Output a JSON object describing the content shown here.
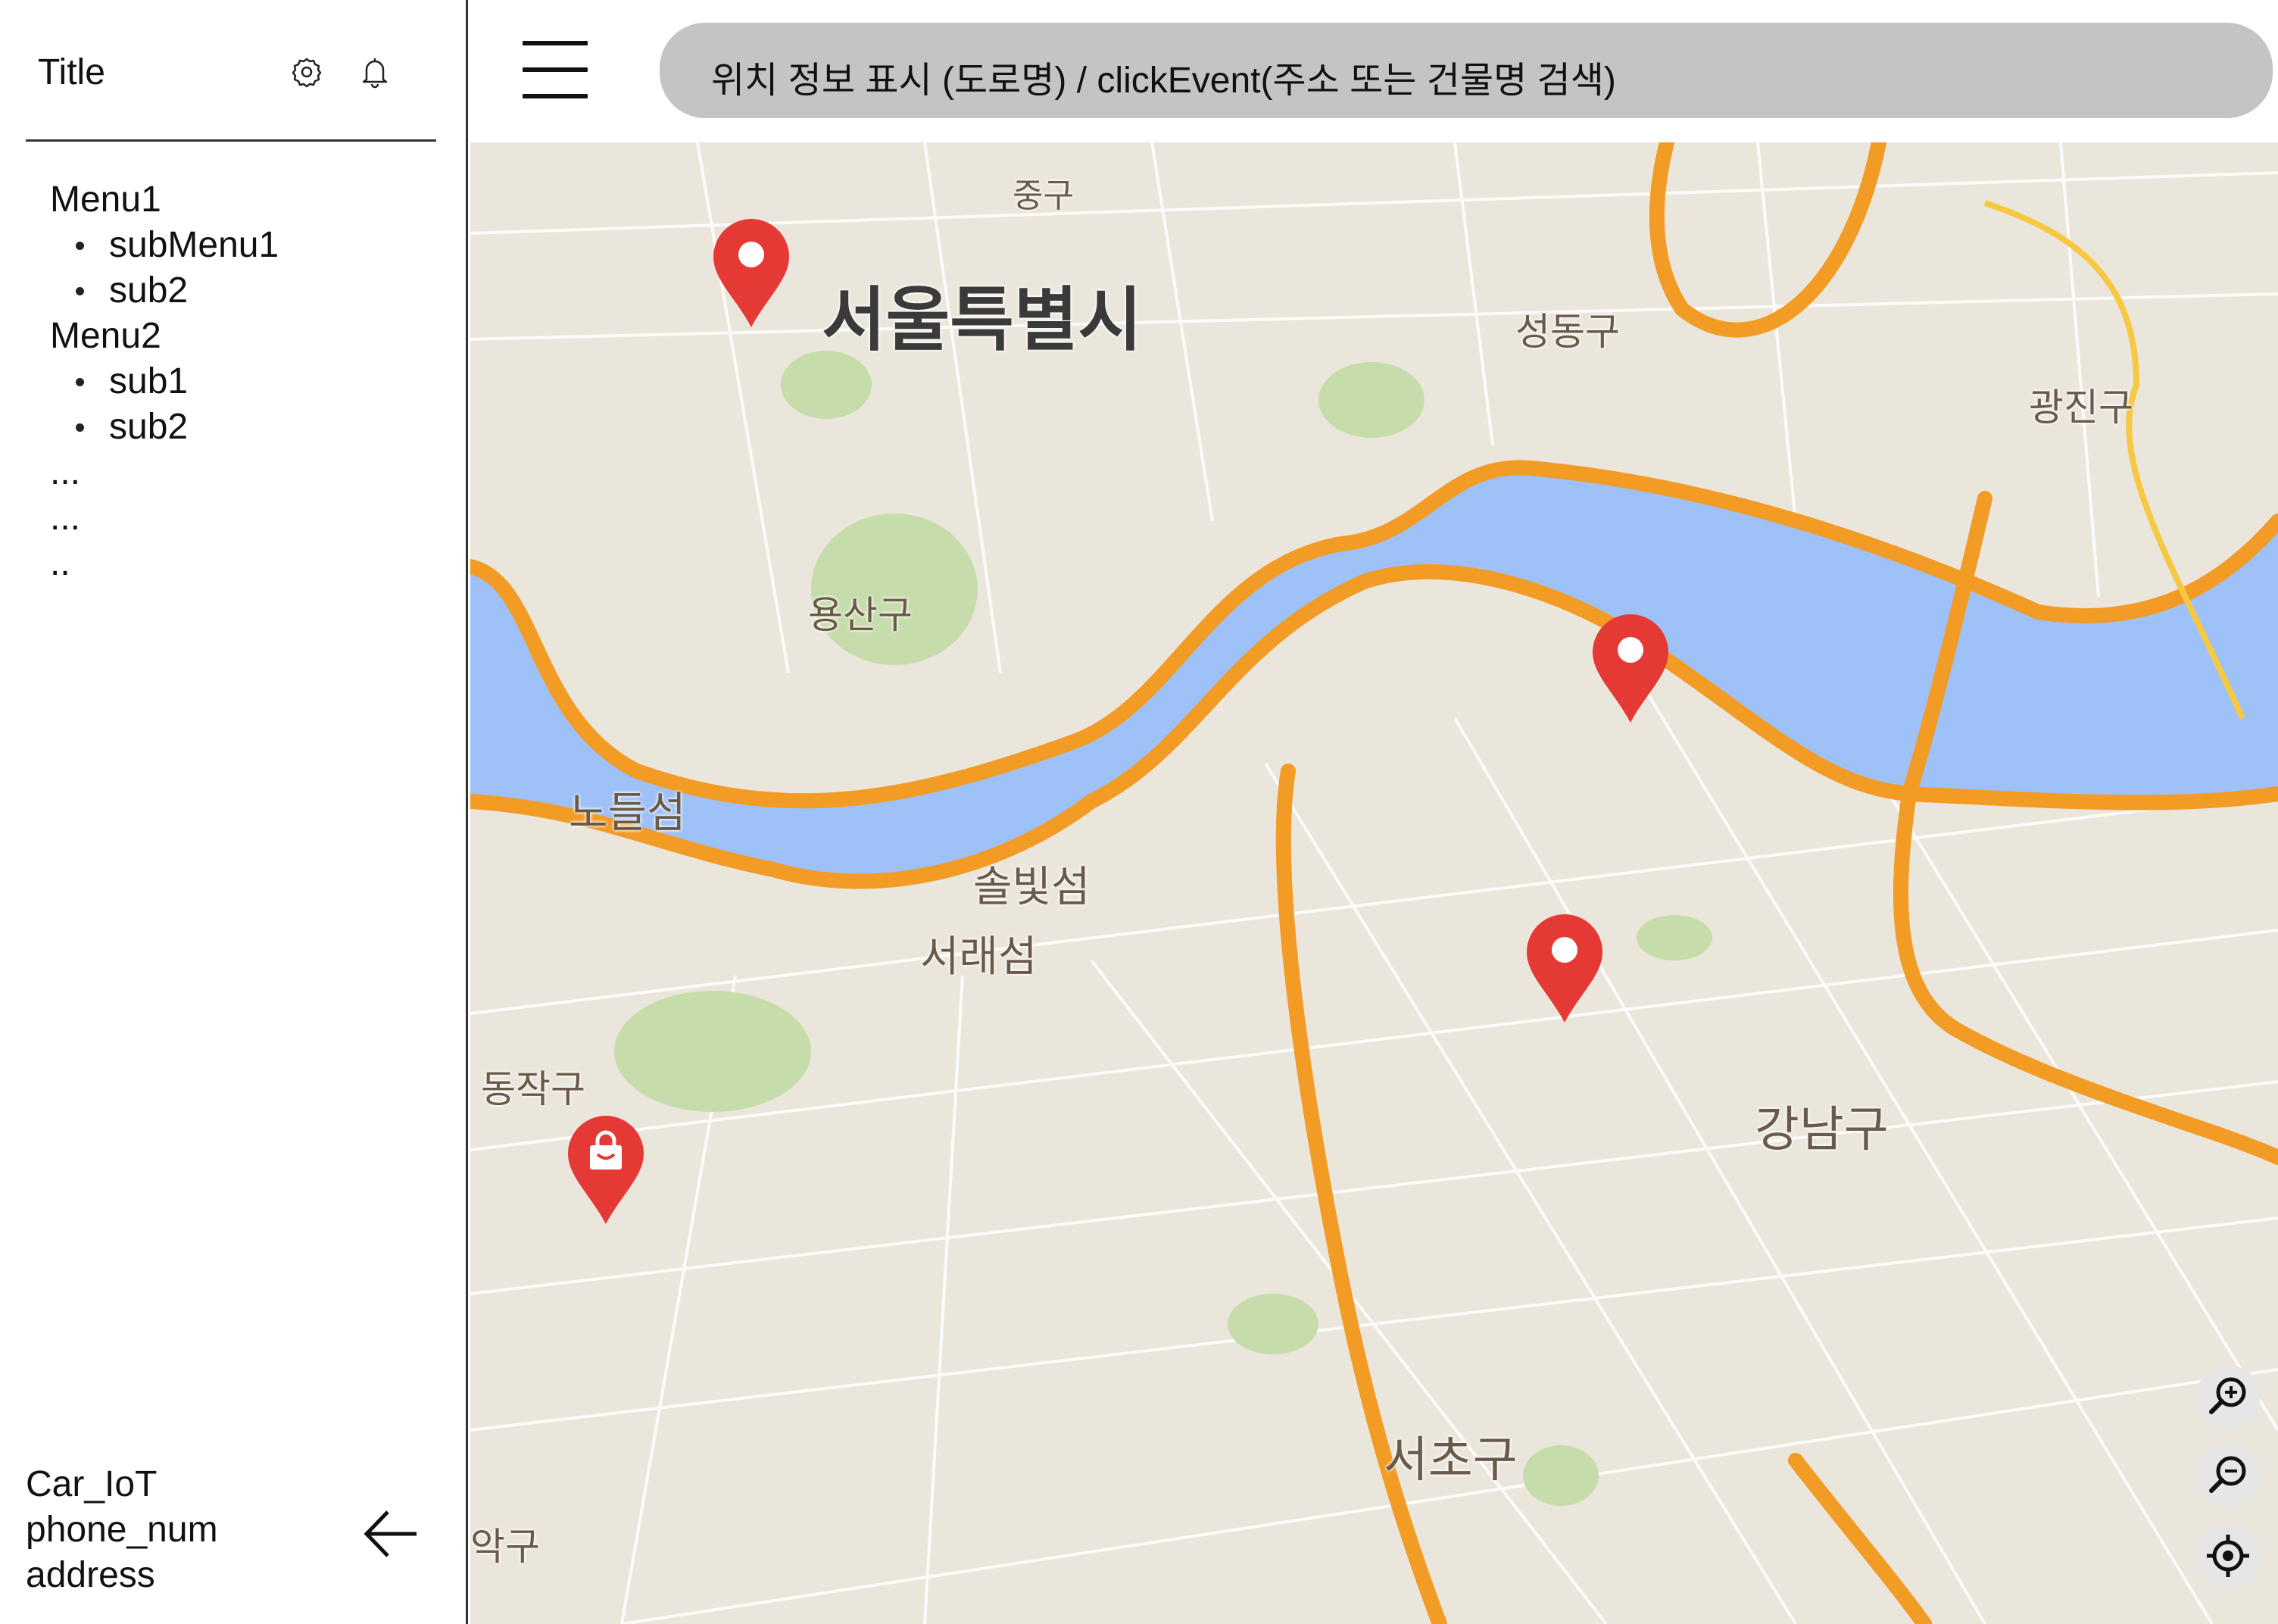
{
  "sidebar": {
    "title": "Title",
    "menu": [
      {
        "label": "Menu1",
        "subs": [
          "subMenu1",
          "sub2"
        ]
      },
      {
        "label": "Menu2",
        "subs": [
          "sub1",
          "sub2"
        ]
      }
    ],
    "extra": [
      "...",
      "...",
      ".."
    ],
    "footer": [
      "Car_IoT",
      "phone_num",
      "address"
    ],
    "icons": [
      "gear-icon",
      "bell-icon",
      "back-arrow-icon"
    ]
  },
  "header": {
    "menu_icon": "hamburger-icon",
    "search_text": "위치 정보 표시 (도로명)  / clickEvent(주소 또는 건물명 검색)"
  },
  "map": {
    "labels": {
      "junggu": "중구",
      "seoul": "서울특별시",
      "seongdong": "성동구",
      "gwangjin": "광진구",
      "yongsan": "용산구",
      "nodeulseom": "노들섬",
      "solbitseom": "솔빛섬",
      "seoraeseom": "서래섬",
      "dongjak": "동작구",
      "gangnam": "강남구",
      "seocho": "서초구",
      "gwanak": "악구"
    },
    "pins": [
      "location-pin",
      "location-pin",
      "location-pin",
      "shopping-pin"
    ],
    "controls": [
      "zoom-in-icon",
      "zoom-out-icon",
      "my-location-icon"
    ]
  },
  "colors": {
    "river": "#9ec1f7",
    "highway": "#f29b25",
    "land": "#ebe6dc",
    "park": "#c6dcaa",
    "pin": "#e53935",
    "search_bar": "#c4c4c4"
  }
}
